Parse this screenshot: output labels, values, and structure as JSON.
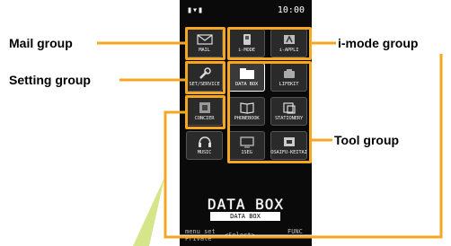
{
  "status": {
    "signal": "▮▾▮",
    "clock": "10:00"
  },
  "callouts": {
    "mail": "Mail group",
    "setting": "Setting group",
    "imode": "i-mode group",
    "tool": "Tool group"
  },
  "menu": {
    "items": [
      {
        "label": "MAIL",
        "icon": "envelope-icon"
      },
      {
        "label": "i-MODE",
        "icon": "i-mode-icon"
      },
      {
        "label": "i-APPLI",
        "icon": "appli-icon"
      },
      {
        "label": "SET/SERVICE",
        "icon": "wrench-icon"
      },
      {
        "label": "DATA BOX",
        "icon": "folder-icon"
      },
      {
        "label": "LIFEKIT",
        "icon": "lifekit-icon"
      },
      {
        "label": "CONCIER",
        "icon": "concierge-icon"
      },
      {
        "label": "PHONEBOOK",
        "icon": "book-icon"
      },
      {
        "label": "STATIONERY",
        "icon": "stationery-icon"
      },
      {
        "label": "MUSIC",
        "icon": "headphones-icon"
      },
      {
        "label": "1SEG",
        "icon": "tv-icon"
      },
      {
        "label": "OSAIFU-KEITAI",
        "icon": "wallet-icon"
      }
    ],
    "selected_index": 4
  },
  "screen": {
    "title": "DATA BOX",
    "subtitle": "DATA BOX",
    "softkey_left_top": "menu set",
    "softkey_left_bottom": "Private",
    "softkey_center": "<Select>",
    "softkey_right": "FUNC"
  },
  "colors": {
    "accent": "#f5a623",
    "pointer": "#d4e58a"
  }
}
